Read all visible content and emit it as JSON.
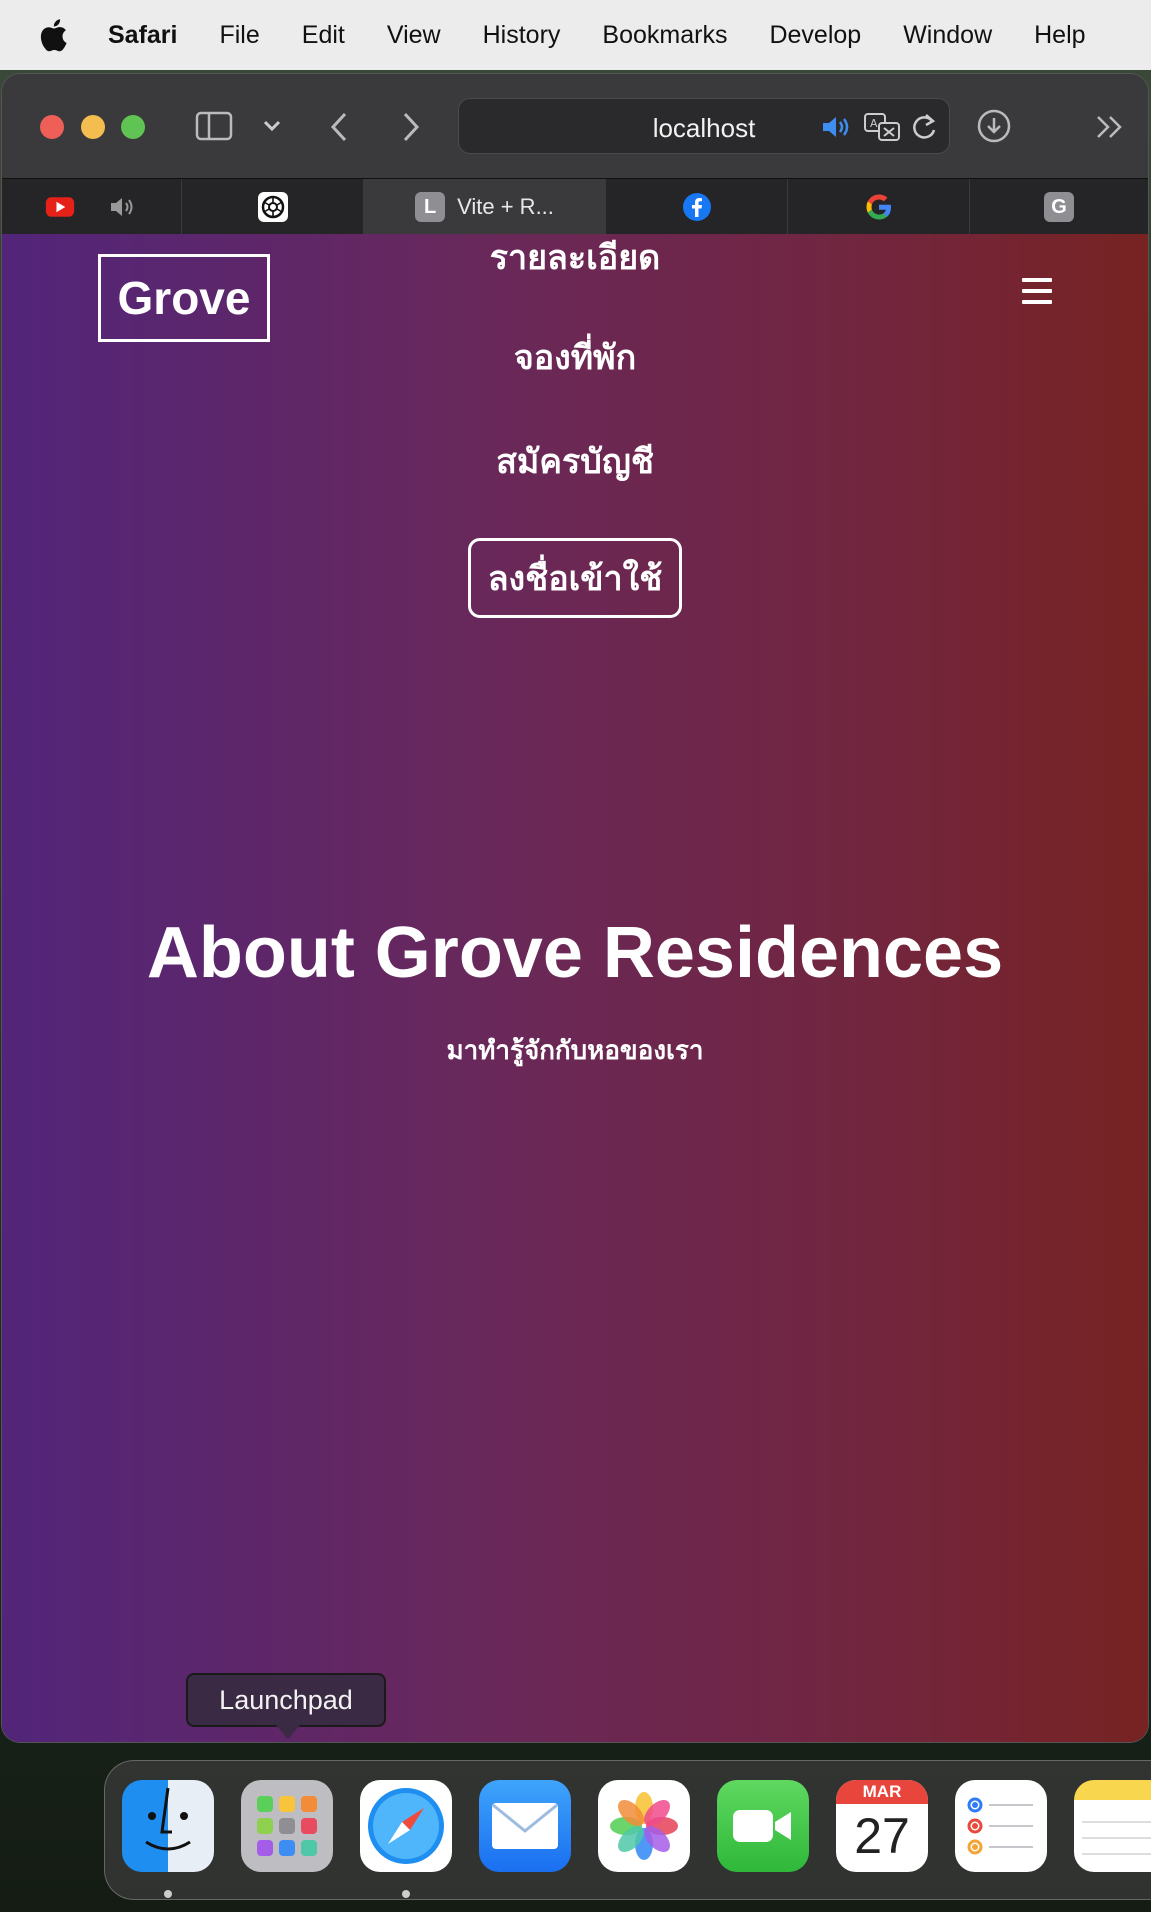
{
  "menubar": {
    "app_name": "Safari",
    "items": [
      "File",
      "Edit",
      "View",
      "History",
      "Bookmarks",
      "Develop",
      "Window",
      "Help"
    ]
  },
  "browser": {
    "url": "localhost",
    "tabs": [
      {
        "title": "",
        "icon": "youtube-icon"
      },
      {
        "title": "",
        "icon": "chatgpt-icon"
      },
      {
        "title": "Vite + R...",
        "icon": "letter-l-icon",
        "favicon_letter": "L"
      },
      {
        "title": "",
        "icon": "facebook-icon"
      },
      {
        "title": "",
        "icon": "google-icon"
      },
      {
        "title": "",
        "icon": "letter-g-icon",
        "favicon_letter": "G"
      }
    ]
  },
  "page": {
    "logo": "Grove",
    "nav": {
      "details": "รายละเอียด",
      "booking": "จองที่พัก",
      "register": "สมัครบัญชี",
      "login": "ลงชื่อเข้าใช้"
    },
    "hero_title": "About Grove Residences",
    "hero_subtitle": "มาทำรู้จักกับหอของเรา"
  },
  "dock": {
    "tooltip": "Launchpad",
    "calendar_month": "MAR",
    "calendar_day": "27"
  },
  "colors": {
    "gradient_start": "#52257a",
    "gradient_end": "#772322"
  }
}
